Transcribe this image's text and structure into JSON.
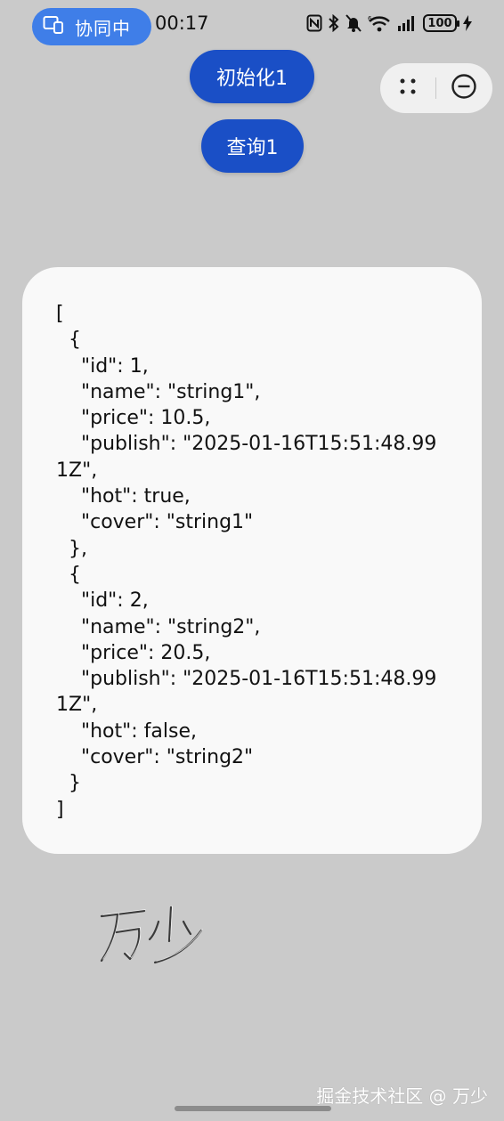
{
  "status_bar": {
    "collab_label": "协同中",
    "time": "00:17",
    "battery": "100"
  },
  "buttons": {
    "init_label": "初始化1",
    "query_label": "查询1"
  },
  "capsule": {
    "more_icon": "more-dots-icon",
    "close_icon": "close-circle-icon"
  },
  "result": {
    "text": "[\n  {\n    \"id\": 1,\n    \"name\": \"string1\",\n    \"price\": 10.5,\n    \"publish\": \"2025-01-16T15:51:48.991Z\",\n    \"hot\": true,\n    \"cover\": \"string1\"\n  },\n  {\n    \"id\": 2,\n    \"name\": \"string2\",\n    \"price\": 20.5,\n    \"publish\": \"2025-01-16T15:51:48.991Z\",\n    \"hot\": false,\n    \"cover\": \"string2\"\n  }\n]"
  },
  "signature": "万少",
  "watermark": "掘金技术社区 @ 万少",
  "colors": {
    "background": "#cacaca",
    "button": "#1a4fc6",
    "collab_pill": "#3f7ee8",
    "card": "#f9f9f9"
  }
}
